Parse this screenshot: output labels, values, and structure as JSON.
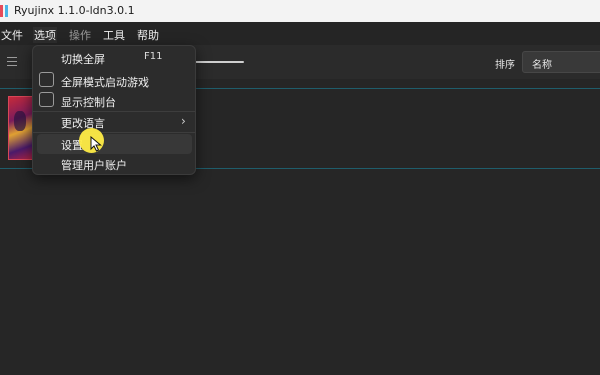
{
  "window": {
    "title": "Ryujinx 1.1.0-ldn3.0.1"
  },
  "menubar": {
    "items": [
      {
        "label": "文件"
      },
      {
        "label": "选项"
      },
      {
        "label": "操作"
      },
      {
        "label": "工具"
      },
      {
        "label": "帮助"
      }
    ]
  },
  "toolbar": {
    "sort_label": "排序",
    "sort_value": "名称"
  },
  "options_menu": {
    "fullscreen_toggle": {
      "label": "切换全屏",
      "shortcut": "F11"
    },
    "start_fullscreen": {
      "label": "全屏模式启动游戏",
      "checked": false
    },
    "show_console": {
      "label": "显示控制台",
      "checked": false
    },
    "change_language": {
      "label": "更改语言"
    },
    "settings": {
      "label": "设置"
    },
    "manage_profiles": {
      "label": "管理用户账户"
    }
  },
  "colors": {
    "accent_line": "#1f5d6b",
    "cursor_highlight": "#ffec46",
    "background": "#202020",
    "titlebar": "#f3f3f3"
  }
}
